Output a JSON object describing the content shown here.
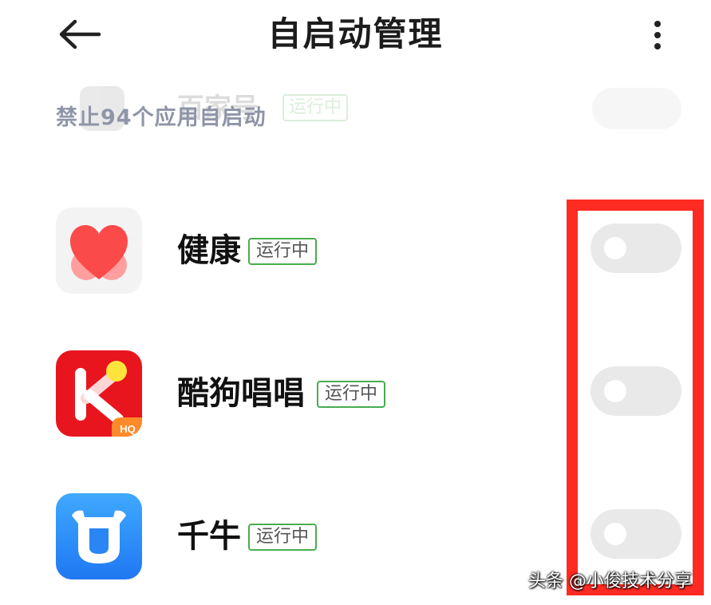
{
  "header": {
    "title": "自启动管理"
  },
  "ghost_row": {
    "name": "百家号",
    "badge": "运行中"
  },
  "section": {
    "caption": "禁止94个应用自启动"
  },
  "apps": [
    {
      "name": "健康",
      "badge": "运行中",
      "icon": "health-heart-icon",
      "enabled": false
    },
    {
      "name": "酷狗唱唱",
      "badge": "运行中",
      "icon": "kugou-changchang-icon",
      "icon_label": "HQ",
      "enabled": false
    },
    {
      "name": "千牛",
      "badge": "运行中",
      "icon": "qianniu-bull-icon",
      "enabled": false
    }
  ],
  "colors": {
    "highlight": "#ff2b22",
    "badge_border": "#48ad4e",
    "caption": "#8f95a8",
    "toggle_off": "#e9e9e9"
  },
  "watermark": "头条 @小俊技术分享"
}
